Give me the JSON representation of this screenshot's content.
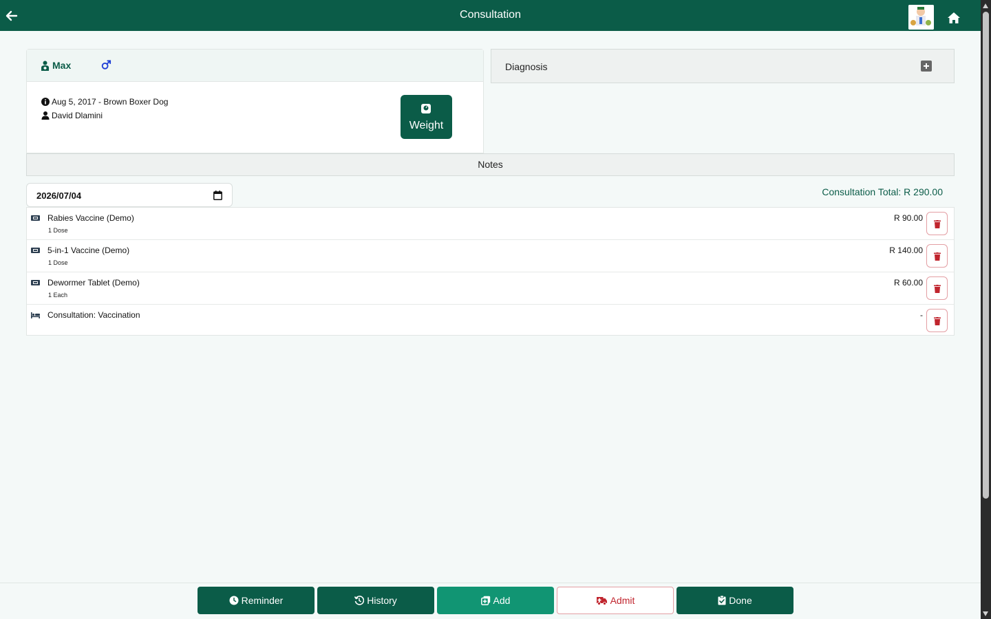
{
  "header": {
    "title": "Consultation"
  },
  "patient": {
    "name": "Max",
    "dob_line": "Aug 5, 2017 - Brown Boxer Dog",
    "owner": "David Dlamini",
    "weight_label": "Weight"
  },
  "diagnosis": {
    "label": "Diagnosis"
  },
  "notes": {
    "label": "Notes"
  },
  "consultation": {
    "date": "2026/07/04",
    "total": "Consultation Total: R 290.00"
  },
  "items": [
    {
      "name": "Rabies Vaccine (Demo)",
      "qty": "1 Dose",
      "price": "R 90.00",
      "icon": "ticket-icon"
    },
    {
      "name": "5-in-1 Vaccine (Demo)",
      "qty": "1 Dose",
      "price": "R 140.00",
      "icon": "ticket-icon"
    },
    {
      "name": "Dewormer Tablet (Demo)",
      "qty": "1 Each",
      "price": "R 60.00",
      "icon": "ticket-icon"
    },
    {
      "name": "Consultation: Vaccination",
      "qty": "",
      "price": "-",
      "icon": "bed-icon"
    }
  ],
  "footer": {
    "reminder": "Reminder",
    "history": "History",
    "add": "Add",
    "admit": "Admit",
    "done": "Done"
  },
  "colors": {
    "primary": "#0b5c48",
    "accent": "#119573",
    "danger": "#c0252e",
    "male": "#1f3fd6"
  }
}
